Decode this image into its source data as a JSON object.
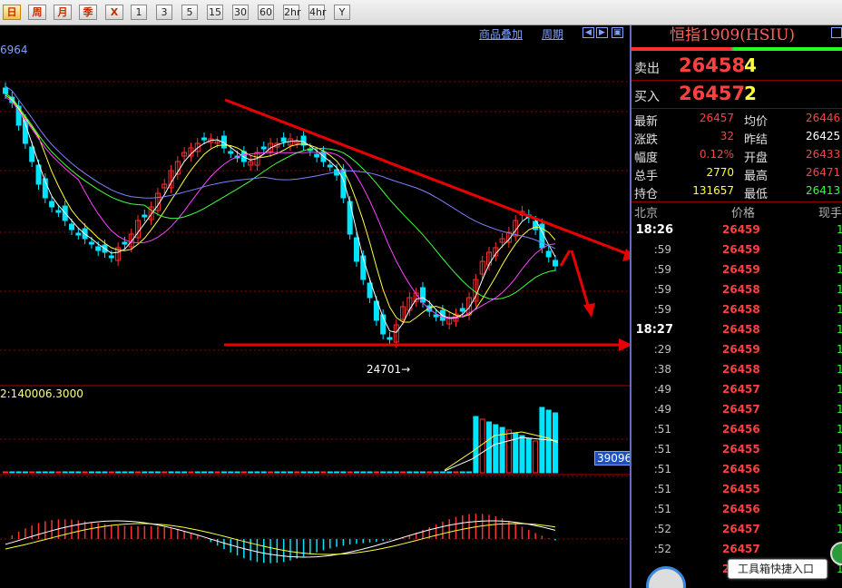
{
  "toolbar": {
    "buttons": [
      "日",
      "周",
      "月",
      "季",
      "X",
      "1",
      "3",
      "5",
      "15",
      "30",
      "60",
      "2hr",
      "4hr",
      "Y"
    ]
  },
  "chart": {
    "links": {
      "overlay": "商品叠加",
      "cycle": "周期"
    },
    "nav": {
      "left": "◀",
      "right": "▶",
      "split": "▣"
    },
    "price_top_label": "6964",
    "low_label": "24701→",
    "vol_label": "2:140006.3000",
    "vol_value_box": "39096"
  },
  "panel": {
    "title": "恒指1909(HSIU)",
    "sell": {
      "label": "卖出",
      "price": "26458",
      "vol": "4"
    },
    "buy": {
      "label": "买入",
      "price": "26457",
      "vol": "2"
    },
    "quote": [
      {
        "l1": "最新",
        "v1": "26457",
        "c1": "red",
        "l2": "均价",
        "v2": "26446",
        "c2": "red"
      },
      {
        "l1": "涨跌",
        "v1": "32",
        "c1": "red",
        "l2": "昨结",
        "v2": "26425",
        "c2": "white"
      },
      {
        "l1": "幅度",
        "v1": "0.12%",
        "c1": "red",
        "l2": "开盘",
        "v2": "26433",
        "c2": "red"
      },
      {
        "l1": "总手",
        "v1": "2770",
        "c1": "yel",
        "l2": "最高",
        "v2": "26471",
        "c2": "red"
      },
      {
        "l1": "持仓",
        "v1": "131657",
        "c1": "yel",
        "l2": "最低",
        "v2": "26413",
        "c2": "grn"
      }
    ],
    "ticks_header": {
      "time": "北京",
      "price": "价格",
      "vol": "现手"
    },
    "ticks": [
      {
        "t": "18:26",
        "p": "26459",
        "big": true
      },
      {
        "t": ":59",
        "p": "26459"
      },
      {
        "t": ":59",
        "p": "26459"
      },
      {
        "t": ":59",
        "p": "26458"
      },
      {
        "t": ":59",
        "p": "26458"
      },
      {
        "t": "18:27",
        "p": "26458",
        "big": true
      },
      {
        "t": ":29",
        "p": "26459"
      },
      {
        "t": ":38",
        "p": "26458"
      },
      {
        "t": ":49",
        "p": "26457"
      },
      {
        "t": ":49",
        "p": "26457"
      },
      {
        "t": ":51",
        "p": "26456"
      },
      {
        "t": ":51",
        "p": "26455"
      },
      {
        "t": ":51",
        "p": "26456"
      },
      {
        "t": ":51",
        "p": "26455"
      },
      {
        "t": ":51",
        "p": "26456"
      },
      {
        "t": ":52",
        "p": "26457"
      },
      {
        "t": ":52",
        "p": "26457"
      },
      {
        "t": "",
        "p": "26457"
      }
    ],
    "tooltip": "工具箱快捷入口"
  },
  "colors": {
    "up": "#ff3030",
    "down": "#00e5ff",
    "grid": "#8b0000",
    "arrow": "#e80000"
  }
}
